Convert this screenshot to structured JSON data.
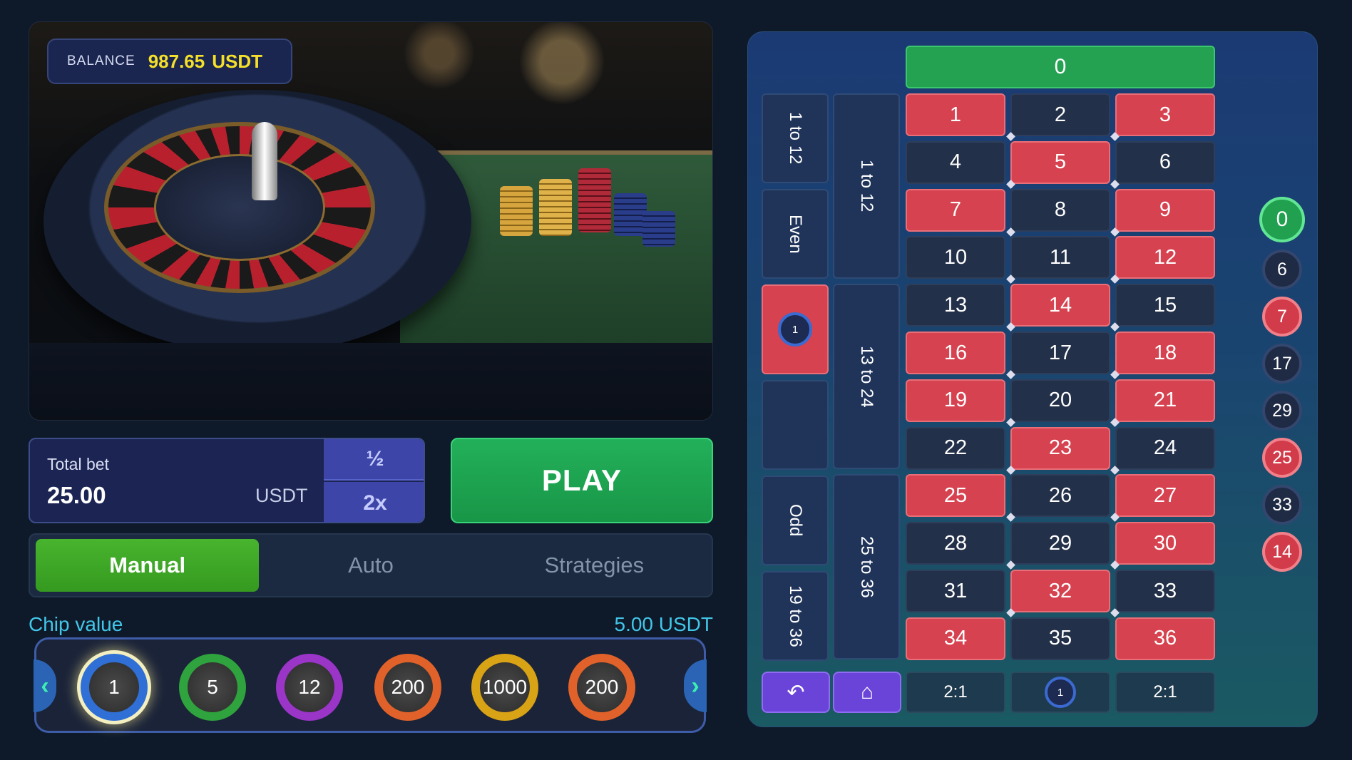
{
  "balance": {
    "label": "BALANCE",
    "amount": "987.65",
    "currency": "USDT"
  },
  "bet": {
    "label": "Total bet",
    "amount": "25.00",
    "currency": "USDT",
    "half": "½",
    "double": "2x"
  },
  "play": "PLAY",
  "tabs": [
    "Manual",
    "Auto",
    "Strategies"
  ],
  "chips": {
    "label": "Chip value",
    "value": "5.00 USDT",
    "items": [
      {
        "value": "1",
        "color": "#2f6fd6"
      },
      {
        "value": "5",
        "color": "#2fa33d"
      },
      {
        "value": "12",
        "color": "#9a35c8"
      },
      {
        "value": "200",
        "color": "#e0622a"
      },
      {
        "value": "1000",
        "color": "#d9a316"
      },
      {
        "value": "200",
        "color": "#e0622a"
      }
    ]
  },
  "board": {
    "zero": "0",
    "numbers": [
      [
        "1",
        "2",
        "3"
      ],
      [
        "4",
        "5",
        "6"
      ],
      [
        "7",
        "8",
        "9"
      ],
      [
        "10",
        "11",
        "12"
      ],
      [
        "13",
        "14",
        "15"
      ],
      [
        "16",
        "17",
        "18"
      ],
      [
        "19",
        "20",
        "21"
      ],
      [
        "22",
        "23",
        "24"
      ],
      [
        "25",
        "26",
        "27"
      ],
      [
        "28",
        "29",
        "30"
      ],
      [
        "31",
        "32",
        "33"
      ],
      [
        "34",
        "35",
        "36"
      ]
    ],
    "red": [
      "1",
      "3",
      "5",
      "7",
      "9",
      "12",
      "14",
      "16",
      "18",
      "19",
      "21",
      "23",
      "25",
      "27",
      "30",
      "32",
      "34",
      "36"
    ],
    "outer": [
      "1 to 12",
      "Even",
      "",
      "",
      "Odd",
      "19 to 36"
    ],
    "dozens": [
      "1 to 12",
      "13 to 24",
      "25 to 36"
    ],
    "columns": [
      "2:1",
      "",
      "2:1"
    ],
    "placed_chip": "1",
    "column_chip": "1"
  },
  "history": [
    {
      "n": "0",
      "c": "grn"
    },
    {
      "n": "6",
      "c": "blk"
    },
    {
      "n": "7",
      "c": "red"
    },
    {
      "n": "17",
      "c": "blk"
    },
    {
      "n": "29",
      "c": "blk"
    },
    {
      "n": "25",
      "c": "red"
    },
    {
      "n": "33",
      "c": "blk"
    },
    {
      "n": "14",
      "c": "red"
    }
  ],
  "icons": {
    "undo": "undo-icon",
    "clear": "broom-icon",
    "prev": "chevron-left-icon",
    "next": "chevron-right-icon"
  }
}
